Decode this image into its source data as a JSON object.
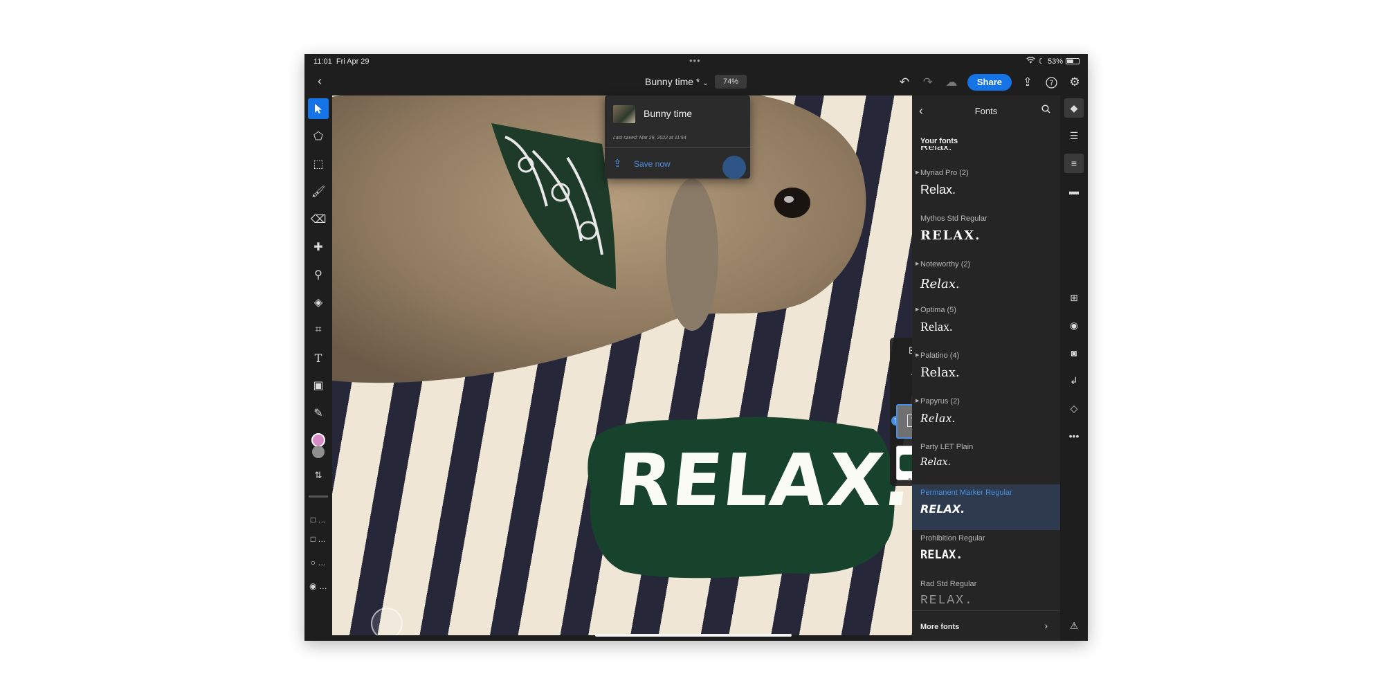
{
  "status": {
    "time": "11:01",
    "date": "Fri Apr 29",
    "battery": "53%"
  },
  "topbar": {
    "doc_title": "Bunny time *",
    "zoom": "74%",
    "share_label": "Share"
  },
  "popover": {
    "title": "Bunny time",
    "last_saved": "Last saved: Mar 29, 2022 at 11:54",
    "save_now": "Save now"
  },
  "canvas": {
    "text_layer": "RELAX."
  },
  "colors": {
    "accent": "#1473e6",
    "primary_swatch": "#d98ac8",
    "secondary_swatch": "#8f8f8f",
    "relax_bg": "#17432d"
  },
  "fonts_panel": {
    "title": "Fonts",
    "section": "Your fonts",
    "cut_off_sample": "Relax.",
    "items": [
      {
        "name": "Myriad Pro (2)",
        "sample": "Relax.",
        "selected": false
      },
      {
        "name": "Mythos Std Regular",
        "sample": "RELAX.",
        "selected": false
      },
      {
        "name": "Noteworthy (2)",
        "sample": "Relax.",
        "selected": false
      },
      {
        "name": "Optima (5)",
        "sample": "Relax.",
        "selected": false
      },
      {
        "name": "Palatino (4)",
        "sample": "Relax.",
        "selected": false
      },
      {
        "name": "Papyrus (2)",
        "sample": "Relax.",
        "selected": false
      },
      {
        "name": "Party LET Plain",
        "sample": "Relax.",
        "selected": false
      },
      {
        "name": "Permanent Marker Regular",
        "sample": "RELAX.",
        "selected": true
      },
      {
        "name": "Prohibition Regular",
        "sample": "RELAX.",
        "selected": false
      },
      {
        "name": "Rad Std Regular",
        "sample": "RELAX.",
        "selected": false
      }
    ],
    "more_fonts": "More fonts"
  }
}
